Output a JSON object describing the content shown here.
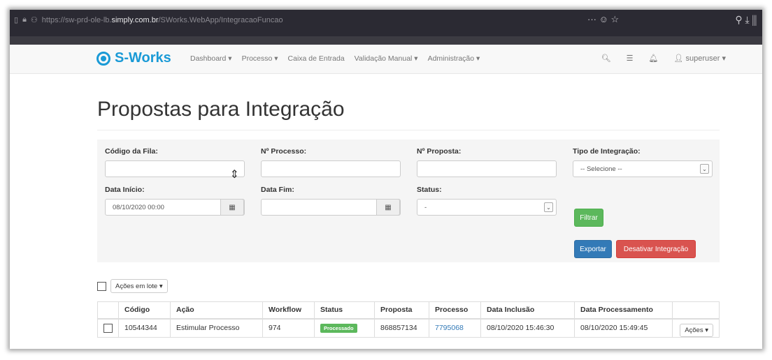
{
  "browser": {
    "url_prefix": "https://sw-prd-ole-lb.",
    "url_host": "simply.com.br",
    "url_path": "/SWorks.WebApp/IntegracaoFuncao",
    "page_actions": "··· ☺ ☆",
    "toolbar_icons": "⚲  ⤓  ⫼"
  },
  "brand": {
    "name": "S-Works",
    "color": "#1a9ad6"
  },
  "nav": {
    "items": [
      {
        "label": "Dashboard ▾"
      },
      {
        "label": "Processo ▾"
      },
      {
        "label": "Caixa de Entrada"
      },
      {
        "label": "Validação Manual ▾"
      },
      {
        "label": "Administração ▾"
      }
    ],
    "user": "superuser ▾"
  },
  "page": {
    "title": "Propostas para Integração"
  },
  "filters": {
    "codigo_fila": {
      "label": "Código da Fila:",
      "value": ""
    },
    "n_processo": {
      "label": "Nº Processo:",
      "value": ""
    },
    "n_proposta": {
      "label": "Nº Proposta:",
      "value": ""
    },
    "tipo_integracao": {
      "label": "Tipo de Integração:",
      "value": "-- Selecione --"
    },
    "data_inicio": {
      "label": "Data Início:",
      "value": "08/10/2020 00:00"
    },
    "data_fim": {
      "label": "Data Fim:",
      "value": ""
    },
    "status": {
      "label": "Status:",
      "value": "-"
    },
    "filtrar_label": "Filtrar",
    "exportar_label": "Exportar",
    "desativar_label": "Desativar Integração"
  },
  "bulk": {
    "label": "Ações em lote ▾"
  },
  "table": {
    "columns": [
      "",
      "Código",
      "Ação",
      "Workflow",
      "Status",
      "Proposta",
      "Processo",
      "Data Inclusão",
      "Data Processamento",
      ""
    ],
    "rows": [
      {
        "codigo": "10544344",
        "acao": "Estimular Processo",
        "workflow": "974",
        "status": "Processado",
        "proposta": "868857134",
        "processo": "7795068",
        "data_inclusao": "08/10/2020 15:46:30",
        "data_processamento": "08/10/2020 15:49:45",
        "acoes": "Ações ▾"
      }
    ]
  },
  "colors": {
    "primary": "#337ab7",
    "success": "#5cb85c",
    "danger": "#d9534f"
  }
}
